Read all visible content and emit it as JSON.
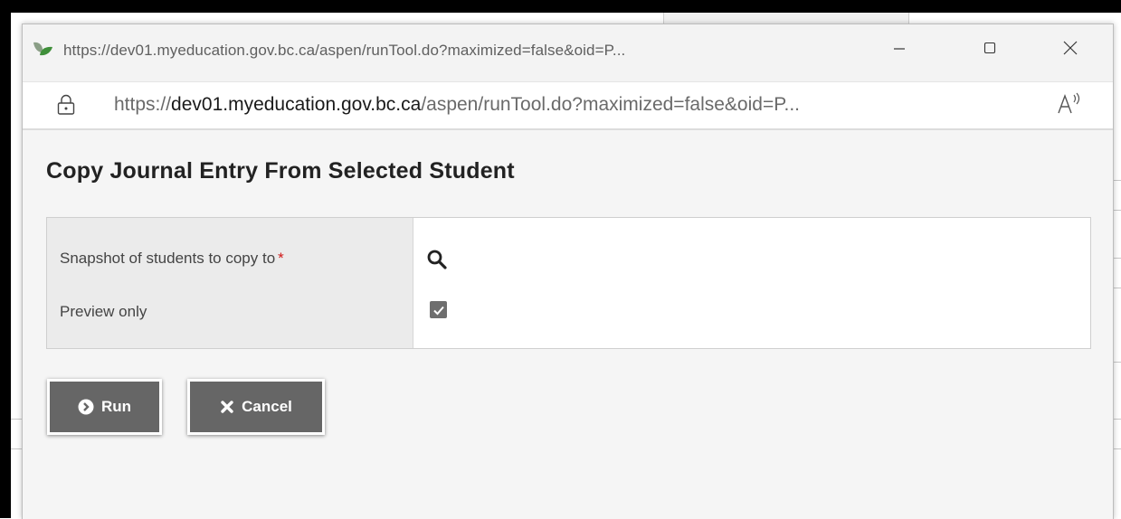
{
  "window": {
    "title": "https://dev01.myeducation.gov.bc.ca/aspen/runTool.do?maximized=false&oid=P...",
    "controls": {
      "minimize": "minimize",
      "maximize": "maximize",
      "close": "close"
    }
  },
  "address_bar": {
    "url_prefix": "https://",
    "url_host": "dev01.myeducation.gov.bc.ca",
    "url_path": "/aspen/runTool.do?maximized=false&oid=P...",
    "read_aloud_icon": "read-aloud-icon"
  },
  "dialog": {
    "title": "Copy Journal Entry From Selected Student",
    "params": [
      {
        "label": "Snapshot of students to copy to",
        "required_mark": "*",
        "control": "search-icon"
      },
      {
        "label": "Preview only",
        "required_mark": "",
        "control": "checkbox",
        "checked": true
      }
    ],
    "buttons": {
      "run": {
        "label": "Run",
        "icon": "chevron-right-circle-icon"
      },
      "cancel": {
        "label": "Cancel",
        "icon": "x-icon"
      }
    }
  },
  "colors": {
    "button_bg": "#666666",
    "required": "#d01818",
    "title_text": "#222222"
  }
}
